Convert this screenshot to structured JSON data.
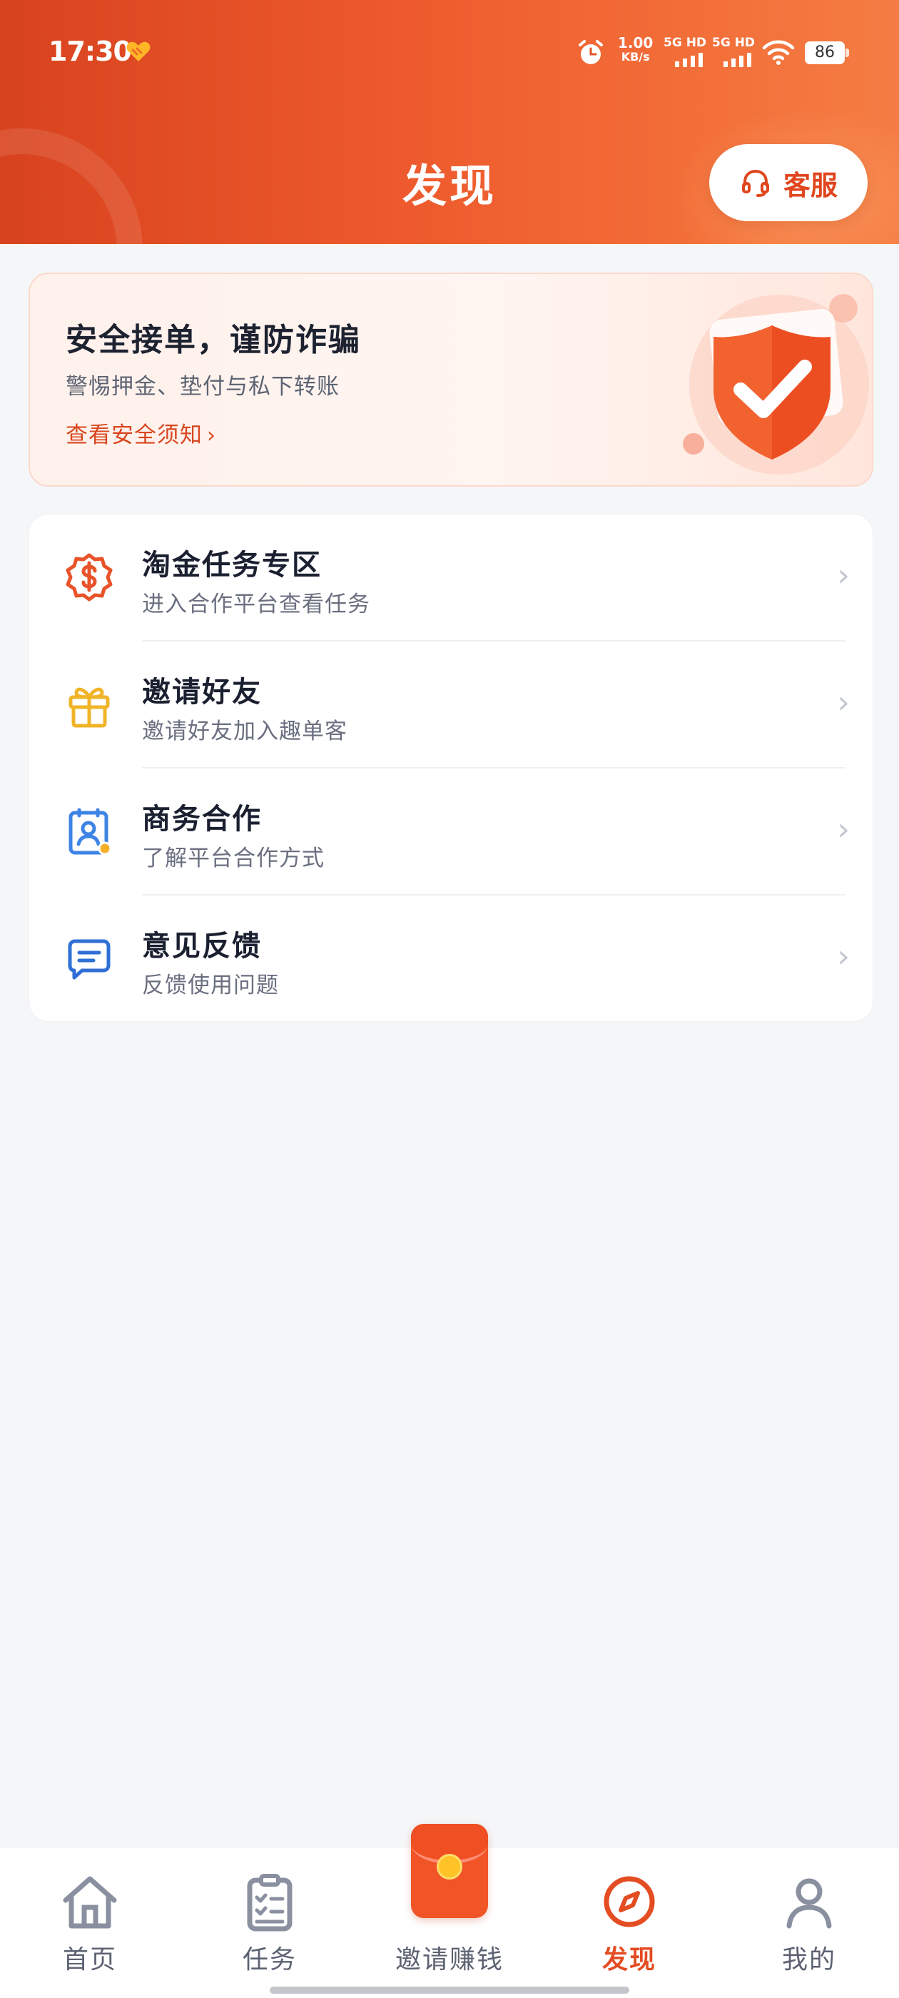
{
  "status_bar": {
    "time": "17:30",
    "net_speed_value": "1.00",
    "net_speed_unit": "KB/s",
    "sim1_label": "5G HD",
    "sim2_label": "5G HD",
    "battery": "86"
  },
  "header": {
    "title": "发现",
    "customer_service_label": "客服"
  },
  "safety_banner": {
    "title": "安全接单，谨防诈骗",
    "subtitle": "警惕押金、垫付与私下转账",
    "link_label": "查看安全须知",
    "link_arrow": "›"
  },
  "menu": {
    "items": [
      {
        "icon": "dollar-badge-icon",
        "title": "淘金任务专区",
        "desc": "进入合作平台查看任务",
        "chevron": "›"
      },
      {
        "icon": "gift-icon",
        "title": "邀请好友",
        "desc": "邀请好友加入趣单客",
        "chevron": "›"
      },
      {
        "icon": "contact-card-icon",
        "title": "商务合作",
        "desc": "了解平台合作方式",
        "chevron": "›"
      },
      {
        "icon": "message-icon",
        "title": "意见反馈",
        "desc": "反馈使用问题",
        "chevron": "›"
      }
    ]
  },
  "bottom_nav": {
    "items": [
      {
        "icon": "home-icon",
        "label": "首页"
      },
      {
        "icon": "clipboard-icon",
        "label": "任务"
      },
      {
        "icon": "red-packet-icon",
        "label": "邀请赚钱"
      },
      {
        "icon": "compass-icon",
        "label": "发现"
      },
      {
        "icon": "user-icon",
        "label": "我的"
      }
    ],
    "active_label": "发现"
  },
  "colors": {
    "brand": "#ee5a2d",
    "active": "#e44c22",
    "text_primary": "#1a2030",
    "text_secondary": "#6a7080"
  }
}
